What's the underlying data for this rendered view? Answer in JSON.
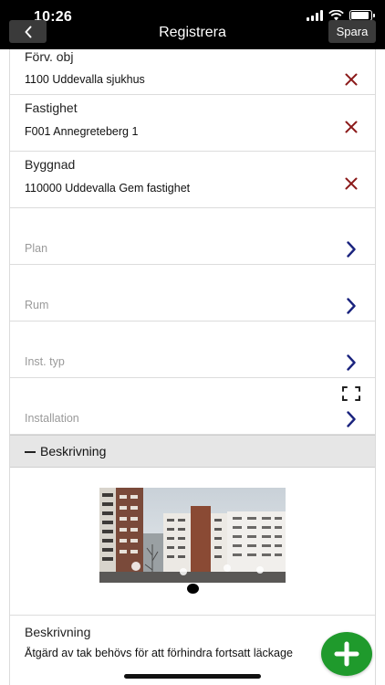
{
  "status_bar": {
    "time": "10:26"
  },
  "nav": {
    "title": "Registrera",
    "save_label": "Spara"
  },
  "fields": [
    {
      "label": "Förv. obj",
      "value": "1100 Uddevalla sjukhus"
    },
    {
      "label": "Fastighet",
      "value": "F001 Annegreteberg 1"
    },
    {
      "label": "Byggnad",
      "value": "110000 Uddevalla Gem fastighet"
    }
  ],
  "pickers": [
    {
      "placeholder": "Plan"
    },
    {
      "placeholder": "Rum"
    },
    {
      "placeholder": "Inst. typ"
    },
    {
      "placeholder": "Installation"
    }
  ],
  "section": {
    "title": "Beskrivning"
  },
  "description": {
    "label": "Beskrivning",
    "value": "Åtgärd av tak behövs för att förhindra fortsatt läckage"
  },
  "colors": {
    "accent_chevron": "#1a237e",
    "clear_icon": "#8b1a1a",
    "fab": "#1f9a2c",
    "top_bar": "#000000",
    "section_bg": "#e6e6e6"
  },
  "icons": {
    "back": "chevron-left-icon",
    "clear": "close-icon",
    "navigate": "chevron-right-icon",
    "scan": "scan-frame-icon",
    "collapse": "minus-icon",
    "add": "plus-icon"
  }
}
